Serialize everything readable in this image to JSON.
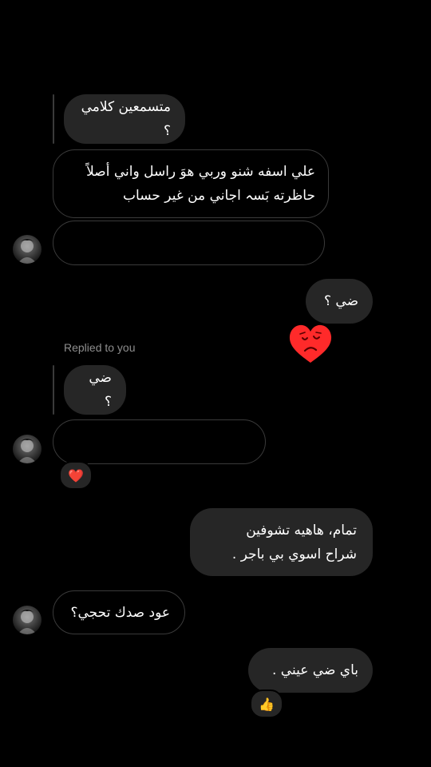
{
  "messages": {
    "quote1_text": "متسمعين كلامي ؟",
    "reply1_text": "علي اسفه شنو وربي هوَ راسل واني أصلاً\nحاظرته بَسہ اجاني من غير حساب",
    "sent1_text": "ضي ؟",
    "replied_label": "Replied to you",
    "quote2_text": "ضي ؟",
    "reaction1": "❤️",
    "sent2_text": "تمام، هاهيه تشوفين\nشراح اسوي بي باجر  .",
    "received3_text": "عود صدك تحجي؟",
    "sent3_text": "باي ضي عيني  .",
    "reaction2": "👍"
  },
  "colors": {
    "bubble": "#262626",
    "outline": "#3a3a3a",
    "muted": "#8e8e8e",
    "sticker_red": "#ff2a2a"
  },
  "icons": {
    "sticker": "sad-heart-sticker-icon",
    "avatar": "profile-avatar"
  }
}
